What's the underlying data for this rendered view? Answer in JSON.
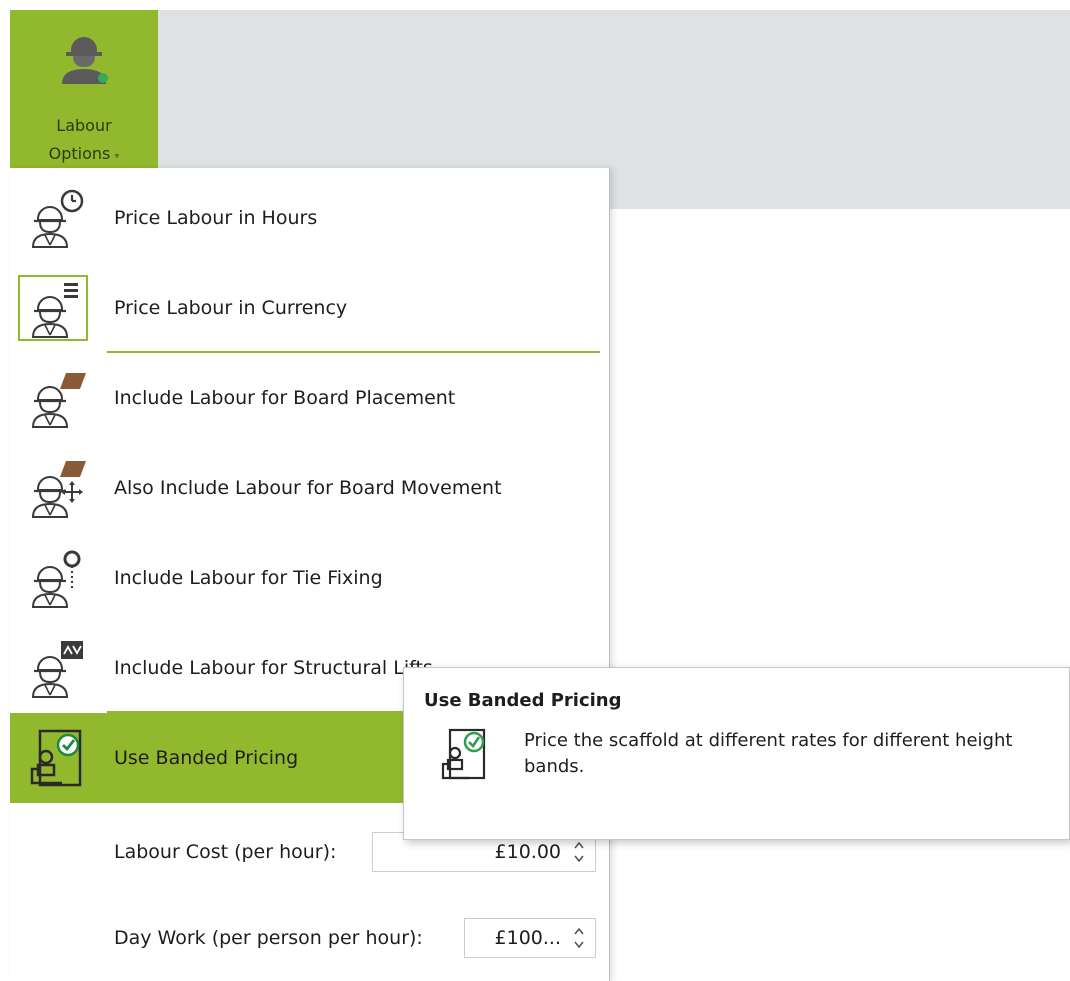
{
  "ribbon": {
    "labour_options": {
      "label_line1": "Labour",
      "label_line2": "Options",
      "caret": "▾",
      "icon": "worker-icon"
    }
  },
  "menu": {
    "items": [
      {
        "label": "Price Labour in Hours",
        "icon": "worker-clock-icon"
      },
      {
        "label": "Price Labour in Currency",
        "icon": "worker-currency-icon"
      },
      {
        "label": "Include Labour for Board Placement",
        "icon": "worker-board-icon"
      },
      {
        "label": "Also Include Labour for Board Movement",
        "icon": "worker-board-move-icon"
      },
      {
        "label": "Include Labour for Tie Fixing",
        "icon": "worker-tie-icon"
      },
      {
        "label": "Include Labour for Structural Lifts",
        "icon": "worker-lifts-icon"
      },
      {
        "label": "Use Banded Pricing",
        "icon": "banded-pricing-icon"
      }
    ],
    "labour_cost": {
      "label": "Labour Cost (per hour):",
      "value": "£10.00"
    },
    "day_work": {
      "label": "Day Work (per person per hour):",
      "value": "£100..."
    }
  },
  "tooltip": {
    "title": "Use Banded Pricing",
    "description": "Price the scaffold at different rates for different height bands.",
    "icon": "banded-pricing-icon"
  },
  "colors": {
    "accent_green": "#92b92e",
    "ribbon_grey": "#dfe2e3",
    "badge_green": "#2e9e4e",
    "board_brown": "#8b5a36"
  }
}
